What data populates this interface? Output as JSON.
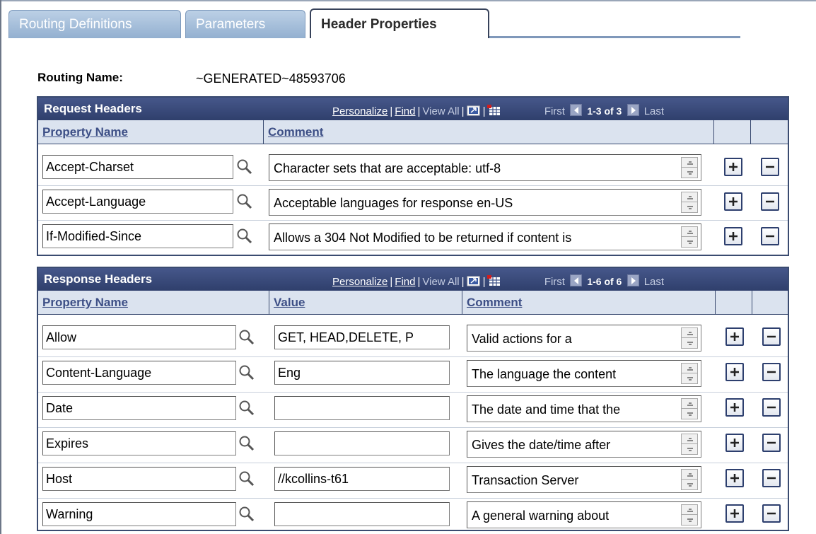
{
  "tabs": [
    {
      "label": "Routing Definitions",
      "active": false
    },
    {
      "label": "Parameters",
      "active": false
    },
    {
      "label": "Header Properties",
      "active": true
    }
  ],
  "routing": {
    "label": "Routing Name:",
    "value": "~GENERATED~48593706"
  },
  "request_headers": {
    "title": "Request Headers",
    "nav": {
      "personalize": "Personalize",
      "find": "Find",
      "view_all": "View All",
      "first": "First",
      "range": "1-3 of 3",
      "last": "Last"
    },
    "columns": {
      "property": "Property Name",
      "comment": "Comment"
    },
    "rows": [
      {
        "property": "Accept-Charset",
        "comment": "Character sets that are acceptable: utf-8"
      },
      {
        "property": "Accept-Language",
        "comment": "Acceptable languages for response en-US"
      },
      {
        "property": "If-Modified-Since",
        "comment": "Allows a 304 Not Modified to be returned if content is"
      }
    ]
  },
  "response_headers": {
    "title": "Response Headers",
    "nav": {
      "personalize": "Personalize",
      "find": "Find",
      "view_all": "View All",
      "first": "First",
      "range": "1-6 of 6",
      "last": "Last"
    },
    "columns": {
      "property": "Property Name",
      "value": "Value",
      "comment": "Comment"
    },
    "rows": [
      {
        "property": "Allow",
        "value": "GET, HEAD,DELETE, P",
        "comment": "Valid actions for a"
      },
      {
        "property": "Content-Language",
        "value": "Eng",
        "comment": "The language the content"
      },
      {
        "property": "Date",
        "value": "",
        "comment": "The date and time that the"
      },
      {
        "property": "Expires",
        "value": "",
        "comment": "Gives the date/time after"
      },
      {
        "property": "Host",
        "value": "//kcollins-t61",
        "comment": "Transaction Server"
      },
      {
        "property": "Warning",
        "value": "",
        "comment": "A general warning about"
      }
    ]
  },
  "icons": {
    "lookup": "magnifier-icon",
    "add": "plus-icon",
    "delete": "minus-icon",
    "spin": "spinner-icon",
    "zoom": "zoom-icon",
    "download": "grid-download-icon"
  }
}
